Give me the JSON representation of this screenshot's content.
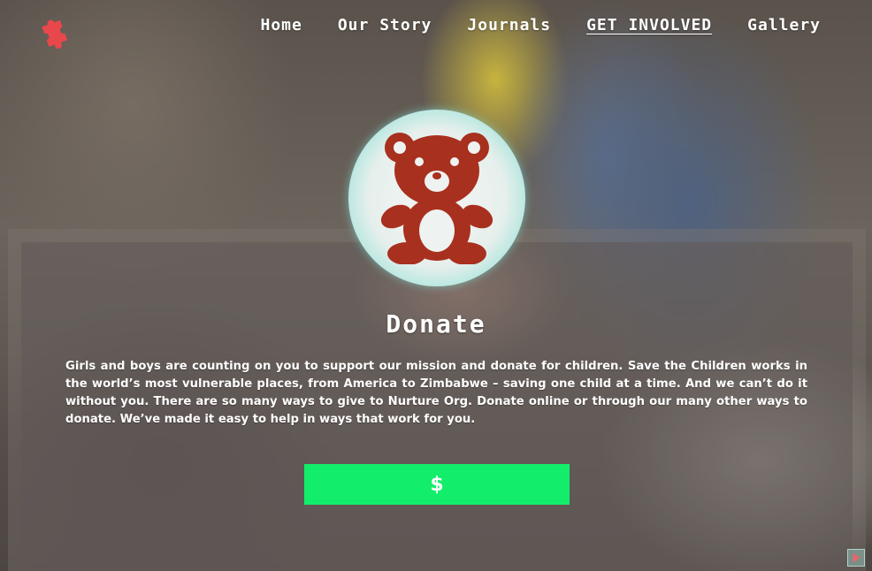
{
  "nav": {
    "logo_icon": "puzzle-piece-icon",
    "logo_color": "#e8474c",
    "items": [
      {
        "label": "Home",
        "active": false
      },
      {
        "label": "Our Story",
        "active": false
      },
      {
        "label": "Journals",
        "active": false
      },
      {
        "label": "GET INVOLVED",
        "active": true
      },
      {
        "label": "Gallery",
        "active": false
      }
    ]
  },
  "badge": {
    "icon": "teddy-bear-icon",
    "icon_color": "#a8301e",
    "ring_color": "#7fd8cc"
  },
  "donate": {
    "title": "Donate",
    "description": "Girls and boys are counting on you to support our mission and donate for children. Save the Children works in the world’s most vulnerable places, from America to Zimbabwe – saving one child at a time. And we can’t do it without you. There are so many ways to give to Nurture Org. Donate online or through our many other ways to donate. We’ve made it easy to help in ways that work for you.",
    "button_label": "$",
    "button_color": "#12ee6c"
  },
  "corner_icon": "play-icon"
}
